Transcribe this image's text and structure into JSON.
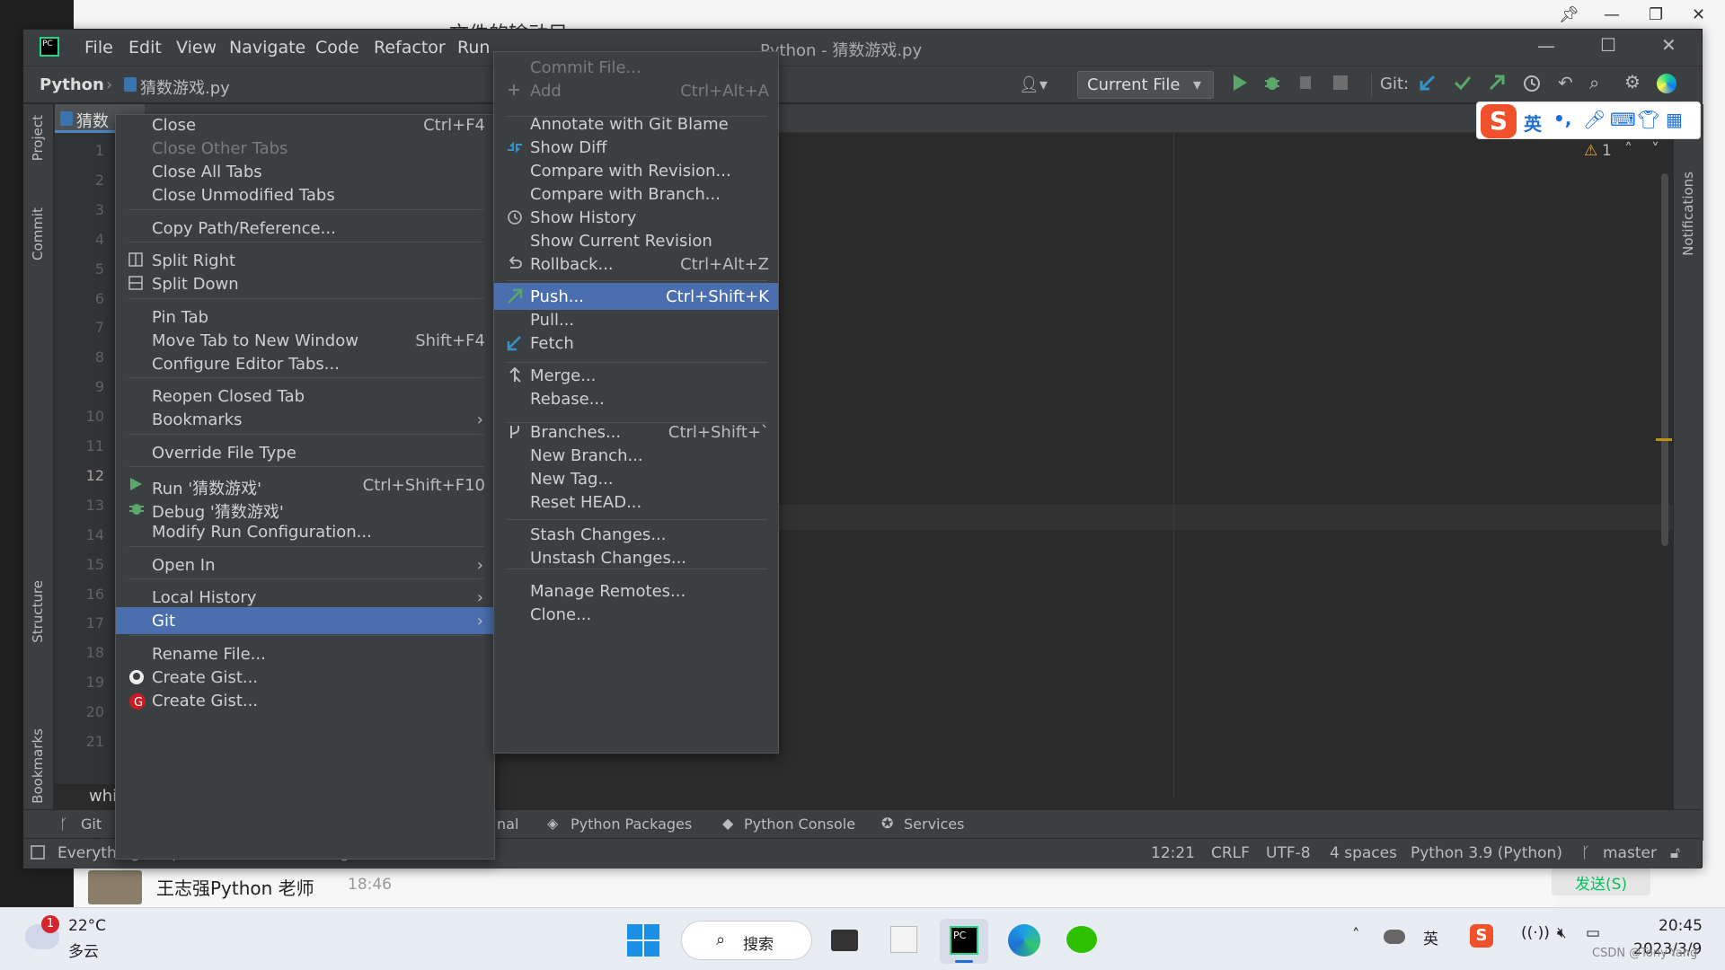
{
  "ide": {
    "title": "Python - 猜数游戏.py",
    "menu": [
      "File",
      "Edit",
      "View",
      "Navigate",
      "Code",
      "Refactor",
      "Run"
    ],
    "breadcrumb_project": "Python",
    "breadcrumb_file": "猜数游戏.py",
    "tab_label": "猜数",
    "run_config": "Current File",
    "git_label": "Git:",
    "line_numbers": [
      "1",
      "2",
      "3",
      "4",
      "5",
      "6",
      "7",
      "8",
      "9",
      "10",
      "11",
      "12",
      "13",
      "14",
      "15",
      "16",
      "17",
      "18",
      "19",
      "20",
      "21"
    ],
    "current_line": "12",
    "code_fragment": "while r",
    "inspection_count": "1",
    "left_tools": [
      "Project",
      "Commit",
      "Structure",
      "Bookmarks"
    ],
    "right_tools": [
      "Notifications"
    ]
  },
  "context_menu": {
    "items": [
      {
        "label": "Close",
        "shortcut": "Ctrl+F4",
        "disabled": false
      },
      {
        "label": "Close Other Tabs",
        "shortcut": "",
        "disabled": true
      },
      {
        "label": "Close All Tabs",
        "shortcut": "",
        "disabled": false
      },
      {
        "label": "Close Unmodified Tabs",
        "shortcut": "",
        "disabled": false
      },
      {
        "label": "Copy Path/Reference...",
        "shortcut": "",
        "disabled": false
      },
      {
        "label": "Split Right",
        "shortcut": "",
        "disabled": false,
        "icon": "split-right-icon"
      },
      {
        "label": "Split Down",
        "shortcut": "",
        "disabled": false,
        "icon": "split-down-icon"
      },
      {
        "label": "Pin Tab",
        "shortcut": "",
        "disabled": false
      },
      {
        "label": "Move Tab to New Window",
        "shortcut": "Shift+F4",
        "disabled": false
      },
      {
        "label": "Configure Editor Tabs...",
        "shortcut": "",
        "disabled": false
      },
      {
        "label": "Reopen Closed Tab",
        "shortcut": "",
        "disabled": false
      },
      {
        "label": "Bookmarks",
        "shortcut": "",
        "disabled": false,
        "submenu": true
      },
      {
        "label": "Override File Type",
        "shortcut": "",
        "disabled": false
      },
      {
        "label": "Run '猜数游戏'",
        "shortcut": "Ctrl+Shift+F10",
        "disabled": false,
        "icon": "run-icon"
      },
      {
        "label": "Debug '猜数游戏'",
        "shortcut": "",
        "disabled": false,
        "icon": "debug-icon"
      },
      {
        "label": "Modify Run Configuration...",
        "shortcut": "",
        "disabled": false
      },
      {
        "label": "Open In",
        "shortcut": "",
        "disabled": false,
        "submenu": true
      },
      {
        "label": "Local History",
        "shortcut": "",
        "disabled": false,
        "submenu": true
      },
      {
        "label": "Git",
        "shortcut": "",
        "disabled": false,
        "submenu": true,
        "selected": true
      },
      {
        "label": "Rename File...",
        "shortcut": "",
        "disabled": false
      },
      {
        "label": "Create Gist...",
        "shortcut": "",
        "disabled": false,
        "icon": "github-icon"
      },
      {
        "label": "Create Gist...",
        "shortcut": "",
        "disabled": false,
        "icon": "gitee-icon"
      }
    ]
  },
  "git_submenu": {
    "items": [
      {
        "label": "Commit File...",
        "shortcut": "",
        "disabled": true
      },
      {
        "label": "Add",
        "shortcut": "Ctrl+Alt+A",
        "disabled": true
      },
      {
        "label": "Annotate with Git Blame",
        "shortcut": "",
        "disabled": false
      },
      {
        "label": "Show Diff",
        "shortcut": "",
        "disabled": false
      },
      {
        "label": "Compare with Revision...",
        "shortcut": "",
        "disabled": false
      },
      {
        "label": "Compare with Branch...",
        "shortcut": "",
        "disabled": false
      },
      {
        "label": "Show History",
        "shortcut": "",
        "disabled": false
      },
      {
        "label": "Show Current Revision",
        "shortcut": "",
        "disabled": false
      },
      {
        "label": "Rollback...",
        "shortcut": "Ctrl+Alt+Z",
        "disabled": false
      },
      {
        "label": "Push...",
        "shortcut": "Ctrl+Shift+K",
        "disabled": false,
        "selected": true
      },
      {
        "label": "Pull...",
        "shortcut": "",
        "disabled": false
      },
      {
        "label": "Fetch",
        "shortcut": "",
        "disabled": false
      },
      {
        "label": "Merge...",
        "shortcut": "",
        "disabled": false
      },
      {
        "label": "Rebase...",
        "shortcut": "",
        "disabled": false
      },
      {
        "label": "Branches...",
        "shortcut": "Ctrl+Shift+`",
        "disabled": false
      },
      {
        "label": "New Branch...",
        "shortcut": "",
        "disabled": false
      },
      {
        "label": "New Tag...",
        "shortcut": "",
        "disabled": false
      },
      {
        "label": "Reset HEAD...",
        "shortcut": "",
        "disabled": false
      },
      {
        "label": "Stash Changes...",
        "shortcut": "",
        "disabled": false
      },
      {
        "label": "Unstash Changes...",
        "shortcut": "",
        "disabled": false
      },
      {
        "label": "Manage Remotes...",
        "shortcut": "",
        "disabled": false
      },
      {
        "label": "Clone...",
        "shortcut": "",
        "disabled": false
      }
    ]
  },
  "tool_windows": {
    "git": "Git",
    "terminal_fragment": "nal",
    "python_packages": "Python Packages",
    "python_console": "Python Console",
    "services": "Services"
  },
  "status": {
    "message": "Everything is up-to-date (moments ago)",
    "position": "12:21",
    "line_sep": "CRLF",
    "encoding": "UTF-8",
    "indent": "4 spaces",
    "interpreter": "Python 3.9 (Python)",
    "branch": "master"
  },
  "background": {
    "title_fragment": "文件的输动目",
    "chat_name": "王志强Python 老师",
    "chat_time": "18:46",
    "chat_action": "发送(S)"
  },
  "ime": {
    "lang": "英"
  },
  "taskbar": {
    "weather_temp": "22°C",
    "weather_desc": "多云",
    "weather_badge": "1",
    "search": "搜索",
    "tray_lang": "英",
    "time": "20:45",
    "date": "2023/3/9",
    "watermark": "CSDN @Tony-Yang"
  },
  "colors": {
    "accent": "#4b6eaf",
    "ide_bg": "#2b2b2b",
    "panel_bg": "#3c3f41",
    "run_green": "#59a869",
    "git_blue": "#3592c4"
  }
}
